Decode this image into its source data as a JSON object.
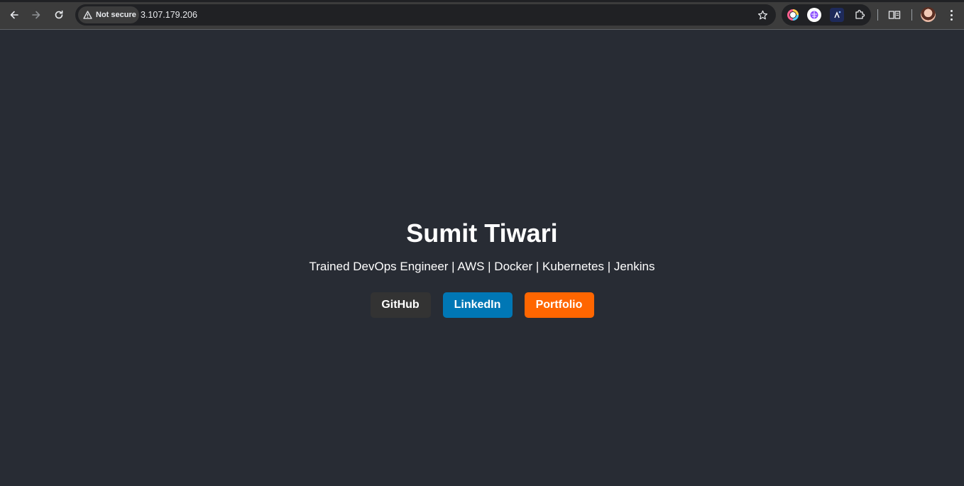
{
  "browser": {
    "security_label": "Not secure",
    "url": "3.107.179.206",
    "icons": [
      "back-icon",
      "forward-icon",
      "reload-icon",
      "warning-icon",
      "star-icon",
      "extension-icon",
      "reading-list-icon",
      "menu-icon"
    ]
  },
  "page": {
    "name": "Sumit Tiwari",
    "tagline": "Trained DevOps Engineer | AWS | Docker | Kubernetes | Jenkins",
    "buttons": {
      "github": "GitHub",
      "linkedin": "LinkedIn",
      "portfolio": "Portfolio"
    }
  },
  "colors": {
    "page_background": "#282c34",
    "github": "#333333",
    "linkedin": "#0077b5",
    "portfolio": "#ff6600"
  }
}
